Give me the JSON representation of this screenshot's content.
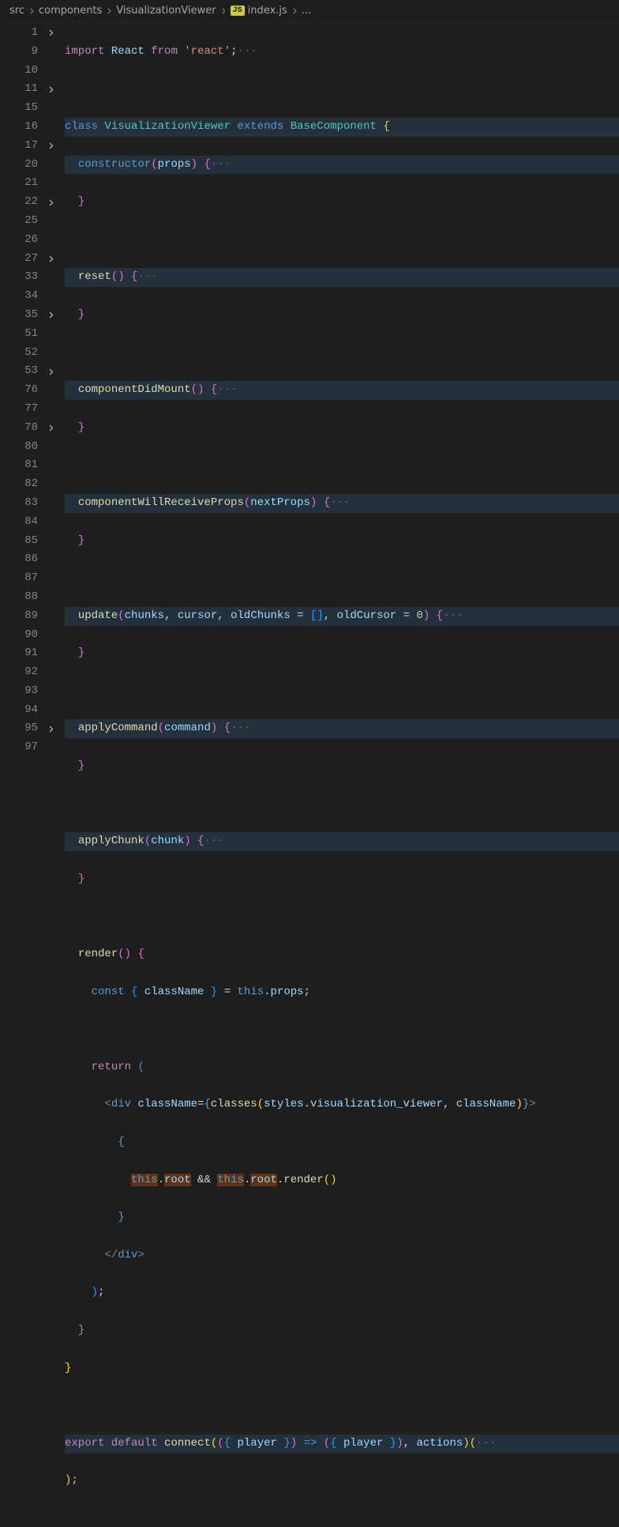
{
  "breadcrumb": {
    "src": "src",
    "components": "components",
    "folder": "VisualizationViewer",
    "jsBadge": "JS",
    "file": "index.js",
    "trailing": "..."
  },
  "lines": [
    {
      "num": "1",
      "fold": true
    },
    {
      "num": "9"
    },
    {
      "num": "10"
    },
    {
      "num": "11",
      "fold": true
    },
    {
      "num": "15"
    },
    {
      "num": "16"
    },
    {
      "num": "17",
      "fold": true
    },
    {
      "num": "20"
    },
    {
      "num": "21"
    },
    {
      "num": "22",
      "fold": true
    },
    {
      "num": "25"
    },
    {
      "num": "26"
    },
    {
      "num": "27",
      "fold": true
    },
    {
      "num": "33"
    },
    {
      "num": "34"
    },
    {
      "num": "35",
      "fold": true
    },
    {
      "num": "51"
    },
    {
      "num": "52"
    },
    {
      "num": "53",
      "fold": true
    },
    {
      "num": "76"
    },
    {
      "num": "77"
    },
    {
      "num": "78",
      "fold": true
    },
    {
      "num": "80"
    },
    {
      "num": "81"
    },
    {
      "num": "82"
    },
    {
      "num": "83"
    },
    {
      "num": "84"
    },
    {
      "num": "85"
    },
    {
      "num": "86"
    },
    {
      "num": "87"
    },
    {
      "num": "88"
    },
    {
      "num": "89"
    },
    {
      "num": "90"
    },
    {
      "num": "91"
    },
    {
      "num": "92"
    },
    {
      "num": "93"
    },
    {
      "num": "94"
    },
    {
      "num": "95",
      "fold": true
    },
    {
      "num": "97"
    }
  ],
  "code": {
    "l1_import": "import",
    "l1_react": "React",
    "l1_from": "from",
    "l1_reactstr": "'react'",
    "ellipsis": "···",
    "l10_class": "class",
    "l10_name": "VisualizationViewer",
    "l10_extends": "extends",
    "l10_base": "BaseComponent",
    "l11_constructor": "constructor",
    "l11_props": "props",
    "l17_reset": "reset",
    "l22_cdm": "componentDidMount",
    "l27_cwrp": "componentWillReceiveProps",
    "l27_nextProps": "nextProps",
    "l35_update": "update",
    "l35_chunks": "chunks",
    "l35_cursor": "cursor",
    "l35_oldChunks": "oldChunks",
    "l35_oldCursor": "oldCursor",
    "l35_zero": "0",
    "l53_applyCommand": "applyCommand",
    "l53_command": "command",
    "l78_applyChunk": "applyChunk",
    "l78_chunk": "chunk",
    "l82_render": "render",
    "l83_const": "const",
    "l83_className": "className",
    "l83_this": "this",
    "l83_props": "props",
    "l85_return": "return",
    "l86_div": "div",
    "l86_className": "className",
    "l86_classes": "classes",
    "l86_styles": "styles",
    "l86_vv": "visualization_viewer",
    "l88_this": "this",
    "l88_root": "root",
    "l88_render": "render",
    "l95_export": "export",
    "l95_default": "default",
    "l95_connect": "connect",
    "l95_player": "player",
    "l95_actions": "actions"
  }
}
